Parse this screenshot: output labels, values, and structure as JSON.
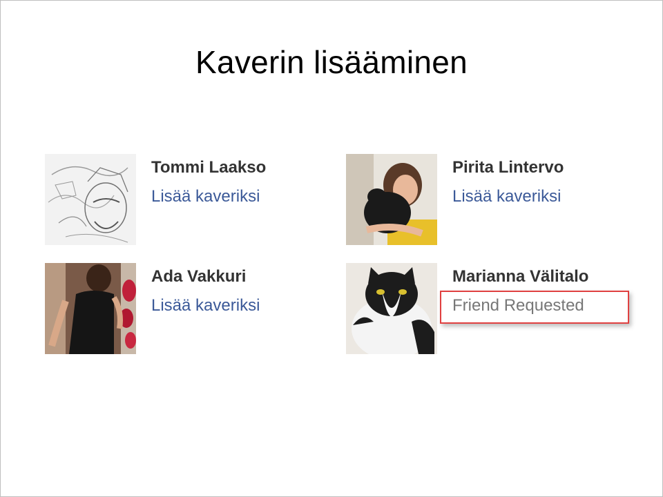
{
  "slide": {
    "title": "Kaverin lisääminen"
  },
  "people": [
    {
      "name": "Tommi Laakso",
      "action": "Lisää kaveriksi"
    },
    {
      "name": "Pirita Lintervo",
      "action": "Lisää kaveriksi"
    },
    {
      "name": "Ada Vakkuri",
      "action": "Lisää kaveriksi"
    },
    {
      "name": "Marianna Välitalo",
      "status": "Friend Requested"
    }
  ],
  "colors": {
    "link": "#3b5998",
    "name": "#333333",
    "status_text": "#777777",
    "highlight_border": "#e04040"
  }
}
